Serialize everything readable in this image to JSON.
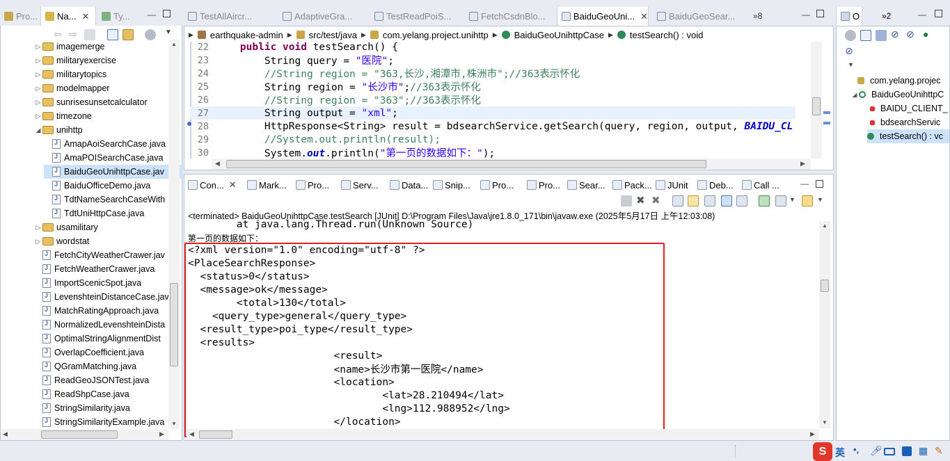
{
  "left_tabs": [
    {
      "label": "Pro...",
      "active": false
    },
    {
      "label": "Na...",
      "active": true
    },
    {
      "label": "Ty...",
      "active": false
    }
  ],
  "package_tree": [
    {
      "label": "imagemerge",
      "kind": "folder",
      "indent": 0,
      "expanded": false
    },
    {
      "label": "militaryexercise",
      "kind": "folder",
      "indent": 0,
      "expanded": false
    },
    {
      "label": "militarytopics",
      "kind": "folder",
      "indent": 0,
      "expanded": false
    },
    {
      "label": "modelmapper",
      "kind": "folder",
      "indent": 0,
      "expanded": false
    },
    {
      "label": "sunrisesunsetcalculator",
      "kind": "folder",
      "indent": 0,
      "expanded": false
    },
    {
      "label": "timezone",
      "kind": "folder",
      "indent": 0,
      "expanded": false
    },
    {
      "label": "unihttp",
      "kind": "folder",
      "indent": 0,
      "expanded": true
    },
    {
      "label": "AmapAoiSearchCase.java",
      "kind": "file",
      "indent": 1
    },
    {
      "label": "AmaPOISearchCase.java",
      "kind": "file",
      "indent": 1
    },
    {
      "label": "BaiduGeoUnihttpCase.jav",
      "kind": "file",
      "indent": 1,
      "selected": true
    },
    {
      "label": "BaiduOfficeDemo.java",
      "kind": "file",
      "indent": 1
    },
    {
      "label": "TdtNameSearchCaseWith",
      "kind": "file",
      "indent": 1
    },
    {
      "label": "TdtUniHttpCase.java",
      "kind": "file",
      "indent": 1
    },
    {
      "label": "usamilitary",
      "kind": "folder",
      "indent": 0,
      "expanded": false
    },
    {
      "label": "wordstat",
      "kind": "folder",
      "indent": 0,
      "expanded": false
    },
    {
      "label": "FetchCityWeatherCrawer.jav",
      "kind": "file",
      "indent": 0
    },
    {
      "label": "FetchWeatherCrawer.java",
      "kind": "file",
      "indent": 0
    },
    {
      "label": "ImportScenicSpot.java",
      "kind": "file",
      "indent": 0
    },
    {
      "label": "LevenshteinDistanceCase.jav",
      "kind": "file",
      "indent": 0
    },
    {
      "label": "MatchRatingApproach.java",
      "kind": "file",
      "indent": 0
    },
    {
      "label": "NormalizedLevenshteinDista",
      "kind": "file",
      "indent": 0
    },
    {
      "label": "OptimalStringAlignmentDist",
      "kind": "file",
      "indent": 0
    },
    {
      "label": "OverlapCoefficient.java",
      "kind": "file",
      "indent": 0
    },
    {
      "label": "QGramMatching.java",
      "kind": "file",
      "indent": 0
    },
    {
      "label": "ReadGeoJSONTest.java",
      "kind": "file",
      "indent": 0
    },
    {
      "label": "ReadShpCase.java",
      "kind": "file",
      "indent": 0
    },
    {
      "label": "StringSimilarity.java",
      "kind": "file",
      "indent": 0
    },
    {
      "label": "StringSimilarityExample.java",
      "kind": "file",
      "indent": 0
    }
  ],
  "editor_tabs": [
    {
      "label": "TestAllAircr...",
      "active": false
    },
    {
      "label": "AdaptiveGra...",
      "active": false
    },
    {
      "label": "TestReadPoiS...",
      "active": false
    },
    {
      "label": "FetchCsdnBlo...",
      "active": false
    },
    {
      "label": "BaiduGeoUni...",
      "active": true
    },
    {
      "label": "BaiduGeoSear...",
      "active": false
    }
  ],
  "editor_overflow": "»8",
  "breadcrumb": [
    "earthquake-admin",
    "src/test/java",
    "com.yelang.project.unihttp",
    "BaiduGeoUnihttpCase",
    "testSearch() : void"
  ],
  "code_lines": [
    {
      "num": "22",
      "parts": [
        {
          "t": "    ",
          "c": ""
        },
        {
          "t": "public",
          "c": "kw"
        },
        {
          "t": " ",
          "c": ""
        },
        {
          "t": "void",
          "c": "kw"
        },
        {
          "t": " testSearch() {",
          "c": ""
        }
      ]
    },
    {
      "num": "23",
      "parts": [
        {
          "t": "        String query = ",
          "c": ""
        },
        {
          "t": "\"医院\"",
          "c": "str"
        },
        {
          "t": ";",
          "c": ""
        }
      ]
    },
    {
      "num": "24",
      "parts": [
        {
          "t": "        ",
          "c": ""
        },
        {
          "t": "//String region = \"363,长沙,湘潭市,株洲市\";//363表示怀化",
          "c": "cmt"
        }
      ]
    },
    {
      "num": "25",
      "parts": [
        {
          "t": "        String region = ",
          "c": ""
        },
        {
          "t": "\"长沙市\"",
          "c": "str"
        },
        {
          "t": ";",
          "c": ""
        },
        {
          "t": "//363表示怀化",
          "c": "cmt"
        }
      ]
    },
    {
      "num": "26",
      "parts": [
        {
          "t": "        ",
          "c": ""
        },
        {
          "t": "//String region = \"363\";//363表示怀化",
          "c": "cmt"
        }
      ]
    },
    {
      "num": "27",
      "parts": [
        {
          "t": "        String output = ",
          "c": ""
        },
        {
          "t": "\"xml\"",
          "c": "str"
        },
        {
          "t": ";",
          "c": ""
        }
      ],
      "highlight": true
    },
    {
      "num": "28",
      "parts": [
        {
          "t": "        HttpResponse<String> result = bdsearchService.getSearch(query, region, output, ",
          "c": ""
        },
        {
          "t": "BAIDU_CL",
          "c": "fld"
        }
      ]
    },
    {
      "num": "29",
      "parts": [
        {
          "t": "        ",
          "c": ""
        },
        {
          "t": "//System.out.println(result);",
          "c": "cmt"
        }
      ]
    },
    {
      "num": "30",
      "parts": [
        {
          "t": "        System.",
          "c": ""
        },
        {
          "t": "out",
          "c": "fld"
        },
        {
          "t": ".println(",
          "c": ""
        },
        {
          "t": "\"第一页的数据如下：\"",
          "c": "str"
        },
        {
          "t": ");",
          "c": ""
        }
      ]
    }
  ],
  "console_tabs": [
    "Con...",
    "Mark...",
    "Pro...",
    "Serv...",
    "Data...",
    "Snip...",
    "Pro...",
    "Pro...",
    "Sear...",
    "Pack...",
    "JUnit",
    "Deb...",
    "Call ..."
  ],
  "console_status": "<terminated> BaiduGeoUnihttpCase.testSearch [JUnit] D:\\Program Files\\Java\\jre1.8.0_171\\bin\\javaw.exe (2025年5月17日 上午12:03:08)",
  "console_lines": [
    "        at java.lang.Thread.run(Unknown Source)",
    "第一页的数据如下：",
    "<?xml version=\"1.0\" encoding=\"utf-8\" ?>",
    "<PlaceSearchResponse>",
    "  <status>0</status>",
    "  <message>ok</message>",
    "        <total>130</total>",
    "    <query_type>general</query_type>",
    "  <result_type>poi_type</result_type>",
    "  <results>",
    "                        <result>",
    "                        <name>长沙市第一医院</name>",
    "                        <location>",
    "                                <lat>28.210494</lat>",
    "                                <lng>112.988952</lng>",
    "                        </location>"
  ],
  "outline_tabs": [
    "O",
    "»2"
  ],
  "outline_items": [
    {
      "label": "com.yelang.projec",
      "kind": "import"
    },
    {
      "label": "BaiduGeoUnihttpC",
      "kind": "class"
    },
    {
      "label": "BAIDU_CLIENT_",
      "kind": "static-field"
    },
    {
      "label": "bdsearchServic",
      "kind": "field"
    },
    {
      "label": "testSearch() : vc",
      "kind": "method",
      "selected": true
    }
  ],
  "taskbar": {
    "ime_label": "英",
    "ime_punct": "•,"
  },
  "colors": {
    "highlight_box": "#e02020",
    "selected_row": "#cde3fb",
    "current_line": "#e8f2fe"
  }
}
